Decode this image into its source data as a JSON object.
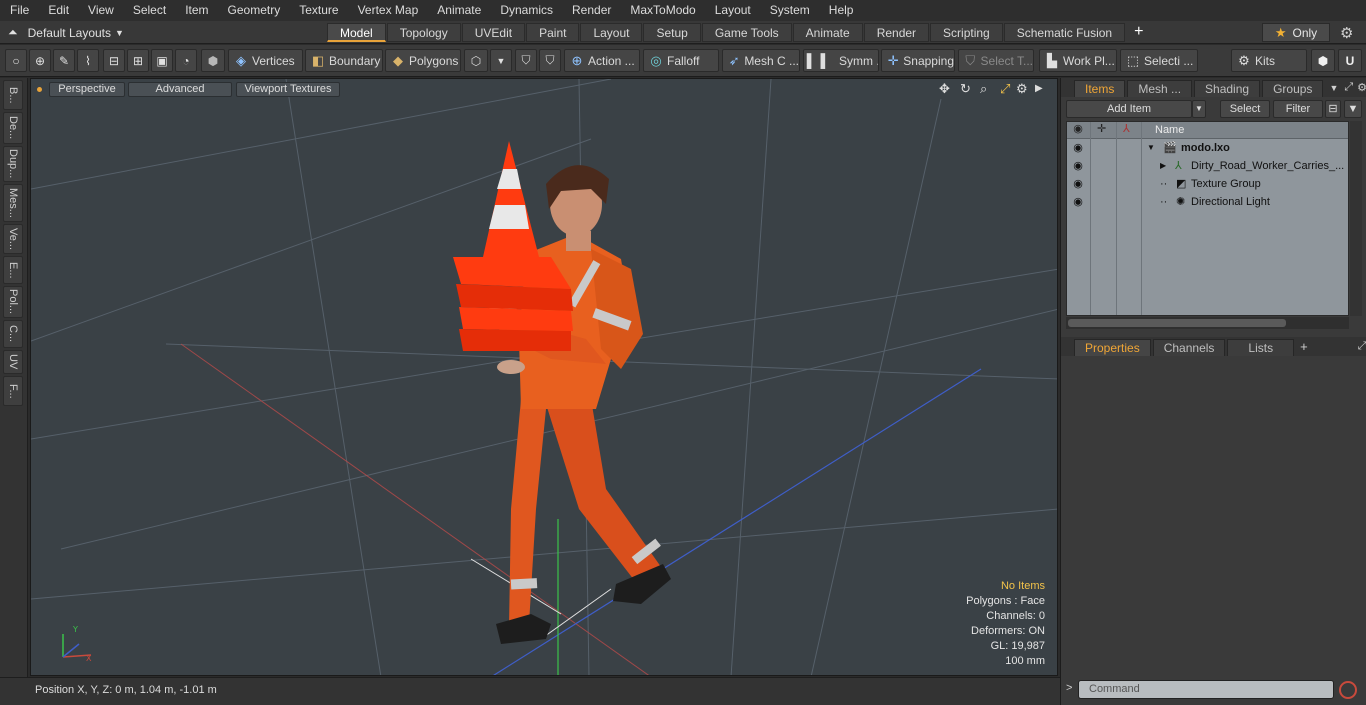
{
  "menu": [
    "File",
    "Edit",
    "View",
    "Select",
    "Item",
    "Geometry",
    "Texture",
    "Vertex Map",
    "Animate",
    "Dynamics",
    "Render",
    "MaxToModo",
    "Layout",
    "System",
    "Help"
  ],
  "layout": {
    "label": "Default Layouts"
  },
  "tabs": [
    "Model",
    "Topology",
    "UVEdit",
    "Paint",
    "Layout",
    "Setup",
    "Game Tools",
    "Animate",
    "Render",
    "Scripting",
    "Schematic Fusion"
  ],
  "only_label": "Only",
  "toolbar": {
    "vertices": "Vertices",
    "boundary": "Boundary",
    "polygons": "Polygons",
    "action": "Action ...",
    "falloff": "Falloff",
    "mesh": "Mesh C ...",
    "symm": "Symm ...",
    "snapping": "Snapping",
    "select_t": "Select T...",
    "work_pl": "Work Pl...",
    "selecti": "Selecti ...",
    "kits": "Kits"
  },
  "left_tabs": [
    "B...",
    "De...",
    "Dup...",
    "Mes...",
    "Ve...",
    "E...",
    "Pol...",
    "C...",
    "UV",
    "F..."
  ],
  "viewport": {
    "perspective": "Perspective",
    "advanced": "Advanced",
    "viewport_textures": "Viewport Textures",
    "info": {
      "no_items": "No Items",
      "polygons": "Polygons : Face",
      "channels": "Channels: 0",
      "deformers": "Deformers: ON",
      "gl": "GL: 19,987",
      "scale": "100 mm"
    }
  },
  "status": {
    "position": "Position X, Y, Z:   0 m, 1.04 m, -1.01 m"
  },
  "items_panel": {
    "tabs": [
      "Items",
      "Mesh ...",
      "Shading",
      "Groups"
    ],
    "add_item": "Add Item",
    "select": "Select",
    "filter": "Filter",
    "name_header": "Name",
    "rows": [
      "modo.lxo",
      "Dirty_Road_Worker_Carries_...",
      "Texture Group",
      "Directional Light"
    ]
  },
  "props_panel": {
    "tabs": [
      "Properties",
      "Channels",
      "Lists"
    ]
  },
  "command": {
    "placeholder": "Command"
  }
}
